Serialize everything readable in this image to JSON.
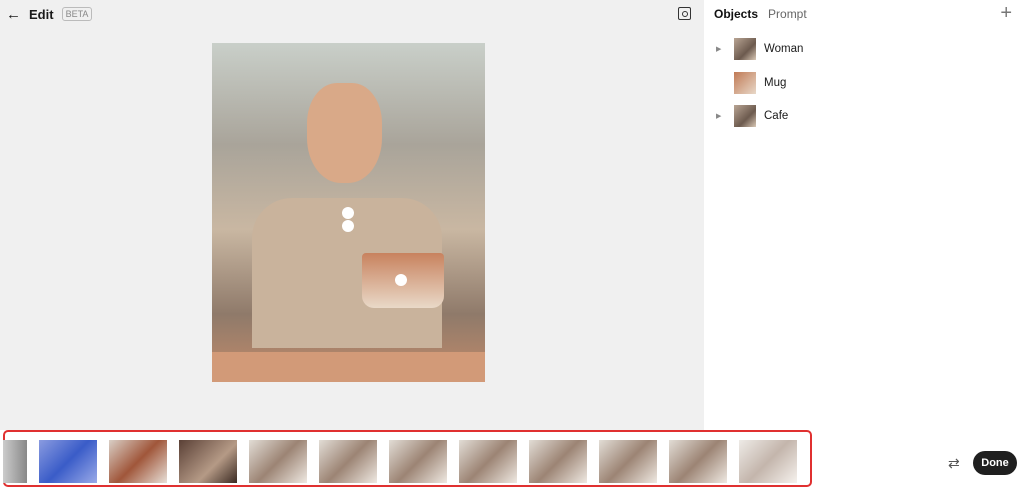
{
  "header": {
    "title": "Edit",
    "badge": "BETA"
  },
  "panel": {
    "tabs": [
      "Objects",
      "Prompt"
    ],
    "objects": [
      {
        "label": "Woman",
        "expandable": true
      },
      {
        "label": "Mug",
        "expandable": false
      },
      {
        "label": "Cafe",
        "expandable": true
      }
    ]
  },
  "footer": {
    "done_label": "Done",
    "thumbnail_count": 12
  },
  "colors": {
    "selection_outline": "#e03030",
    "done_bg": "#1f1f1f"
  }
}
